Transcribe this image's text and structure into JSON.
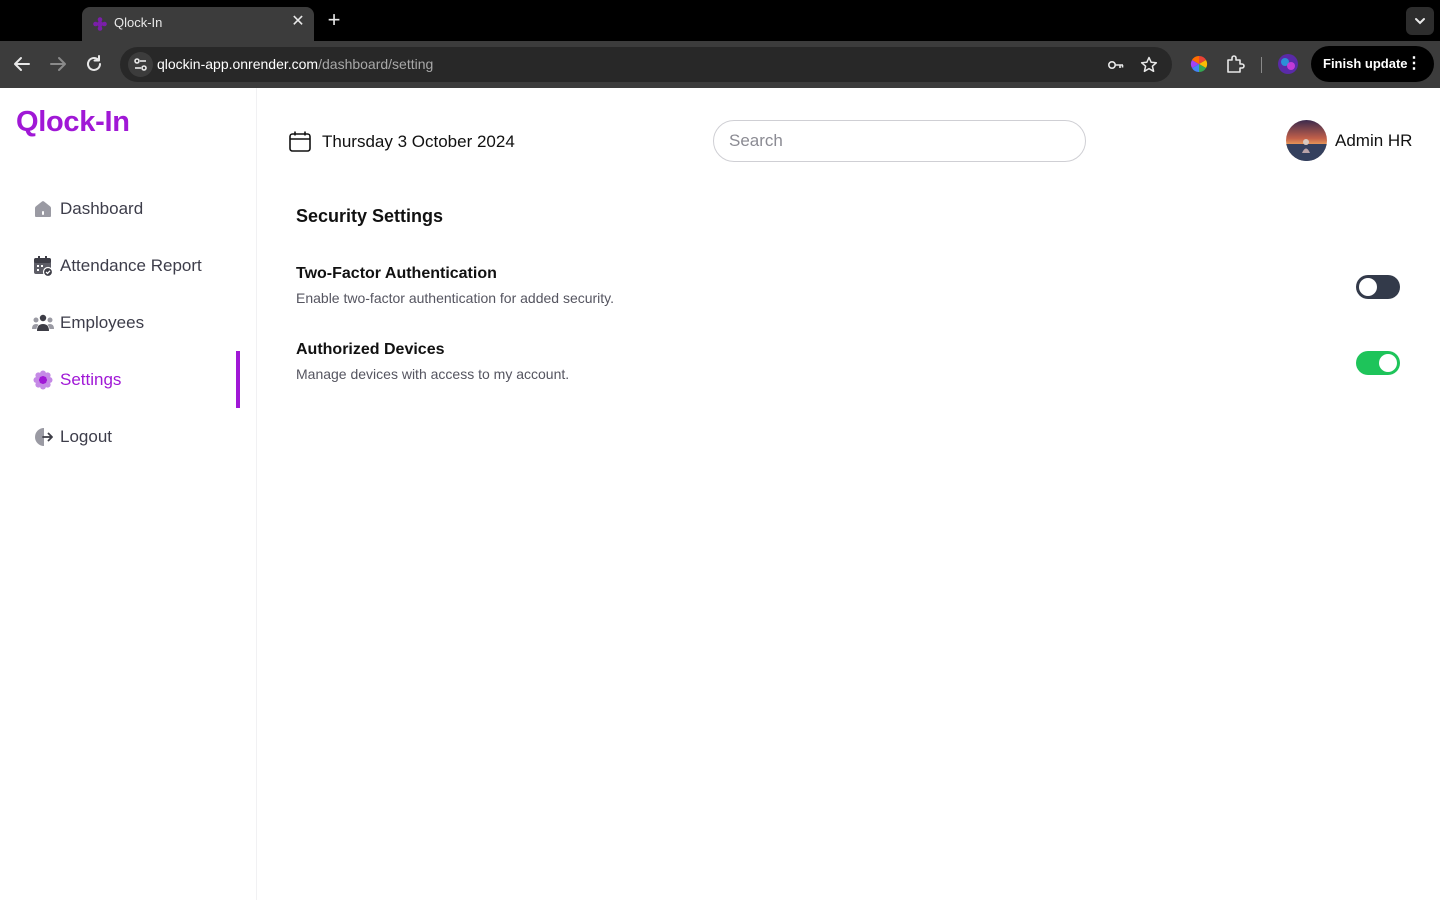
{
  "browser": {
    "tab_title": "Qlock-In",
    "url_host": "qlockin-app.onrender.com",
    "url_path": "/dashboard/setting",
    "finish_update_label": "Finish update"
  },
  "app": {
    "logo": "Qlock-In",
    "brand_color": "#a018d6",
    "sidebar": {
      "items": [
        {
          "label": "Dashboard",
          "icon": "home-icon",
          "active": false
        },
        {
          "label": "Attendance Report",
          "icon": "calendar-check-icon",
          "active": false
        },
        {
          "label": "Employees",
          "icon": "users-icon",
          "active": false
        },
        {
          "label": "Settings",
          "icon": "gear-icon",
          "active": true
        },
        {
          "label": "Logout",
          "icon": "logout-icon",
          "active": false
        }
      ]
    },
    "header": {
      "date": "Thursday 3 October 2024",
      "search_placeholder": "Search",
      "search_value": "",
      "user_name": "Admin HR"
    },
    "main": {
      "section_title": "Security Settings",
      "settings": [
        {
          "title": "Two-Factor Authentication",
          "description": "Enable two-factor authentication for added security.",
          "enabled": false
        },
        {
          "title": "Authorized Devices",
          "description": "Manage devices with access to my account.",
          "enabled": true
        }
      ]
    }
  }
}
